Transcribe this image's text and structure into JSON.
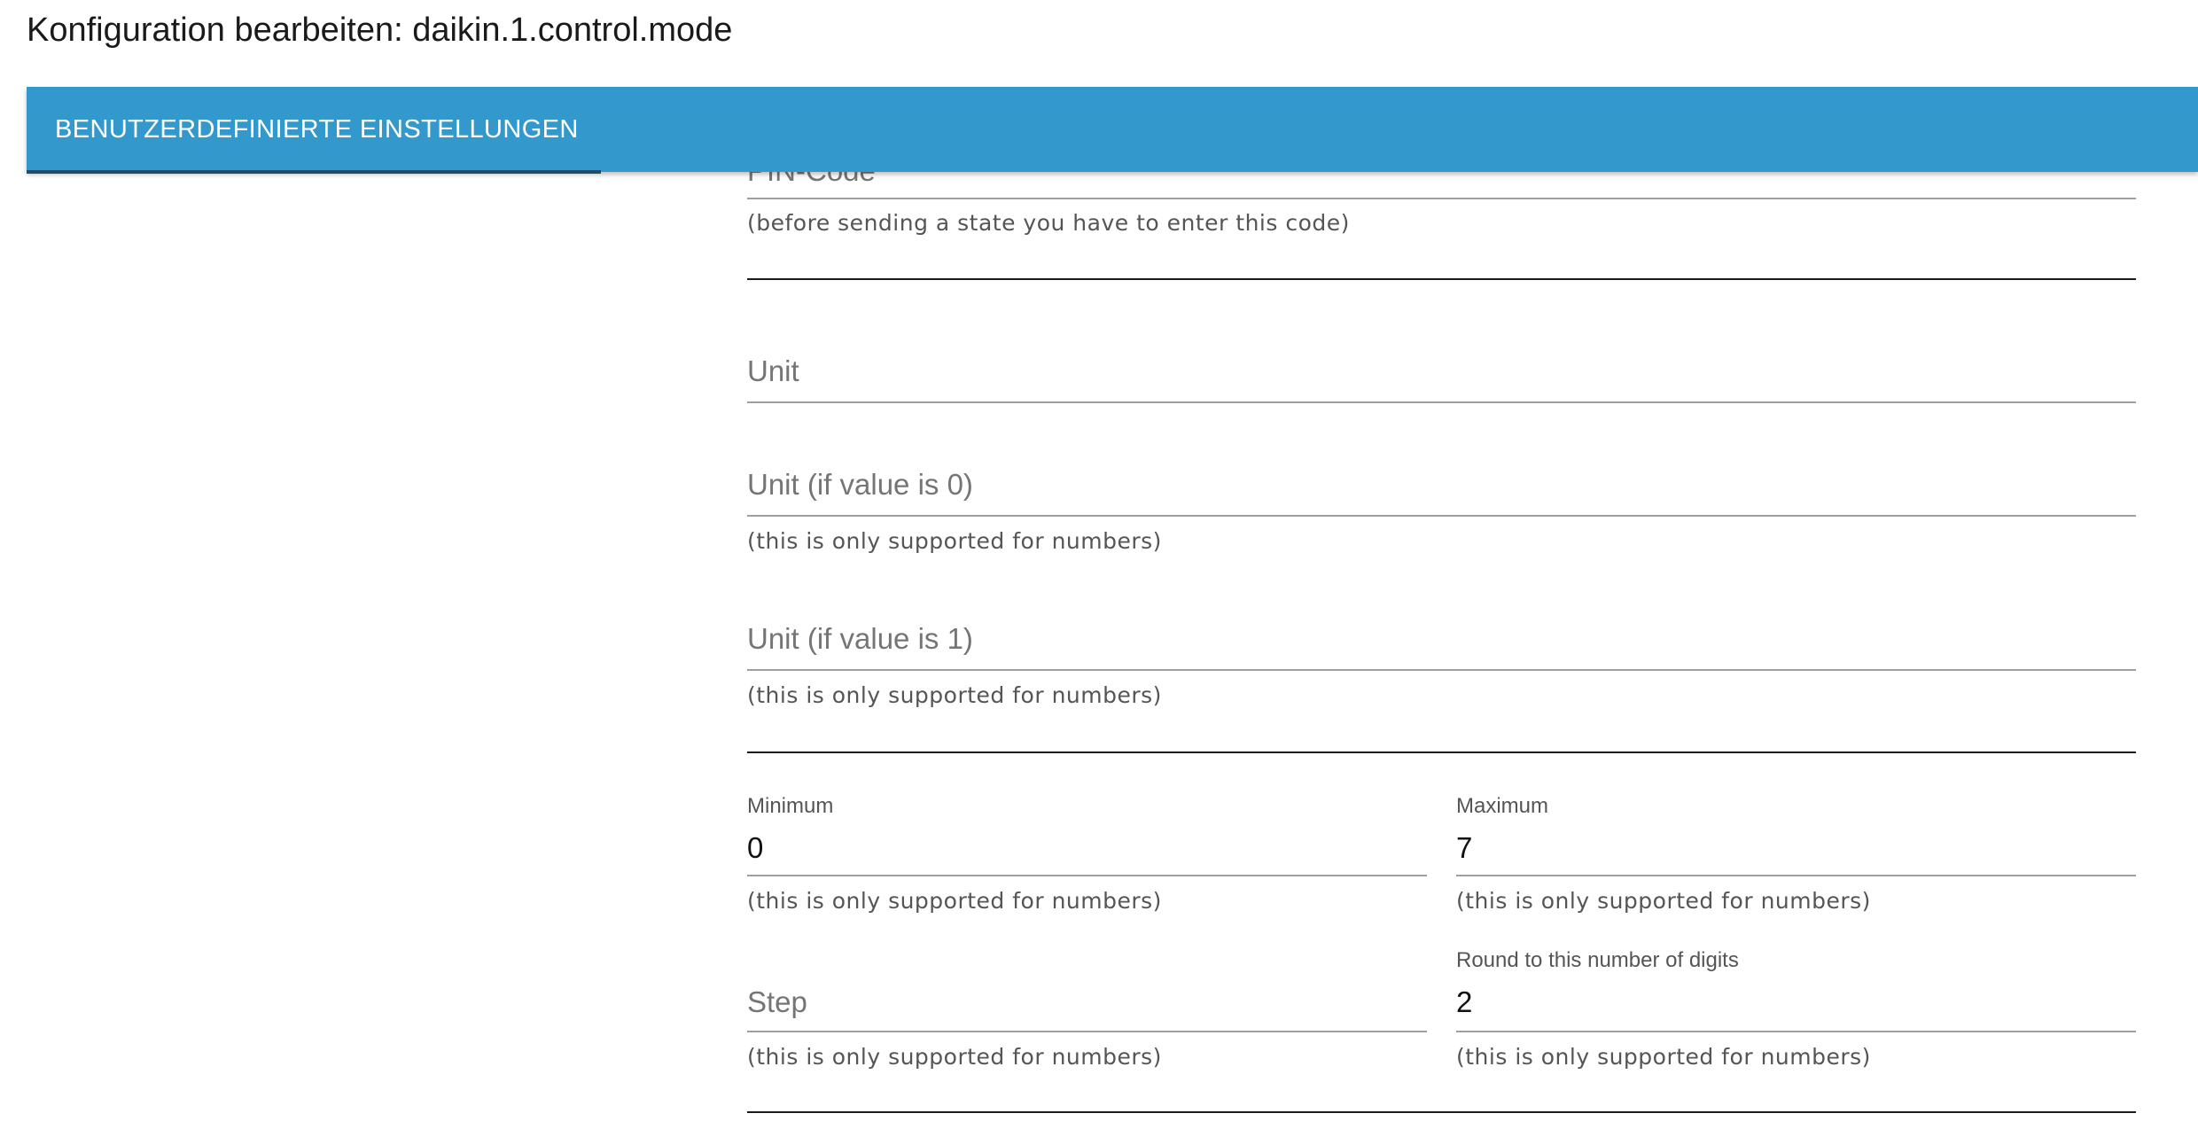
{
  "dialog": {
    "title": "Konfiguration bearbeiten: daikin.1.control.mode"
  },
  "tabs": [
    {
      "label": "BENUTZERDEFINIERTE EINSTELLUNGEN",
      "active": true
    }
  ],
  "colors": {
    "tabbar": "#3399cc",
    "tab_indicator": "#1f4e6e",
    "field_line": "#9e9e9e",
    "label": "#757575"
  },
  "form": {
    "pin_code": {
      "label": "PIN-Code",
      "value": "",
      "helper": "(before sending a state you have to enter this code)"
    },
    "unit": {
      "label": "Unit",
      "value": ""
    },
    "unit_if_0": {
      "label": "Unit (if value is 0)",
      "value": "",
      "helper": "(this is only supported for numbers)"
    },
    "unit_if_1": {
      "label": "Unit (if value is 1)",
      "value": "",
      "helper": "(this is only supported for numbers)"
    },
    "minimum": {
      "label": "Minimum",
      "value": "0",
      "helper": "(this is only supported for numbers)"
    },
    "maximum": {
      "label": "Maximum",
      "value": "7",
      "helper": "(this is only supported for numbers)"
    },
    "step": {
      "label": "Step",
      "value": "",
      "helper": "(this is only supported for numbers)"
    },
    "round_digits": {
      "label": "Round to this number of digits",
      "value": "2",
      "helper": "(this is only supported for numbers)"
    }
  }
}
